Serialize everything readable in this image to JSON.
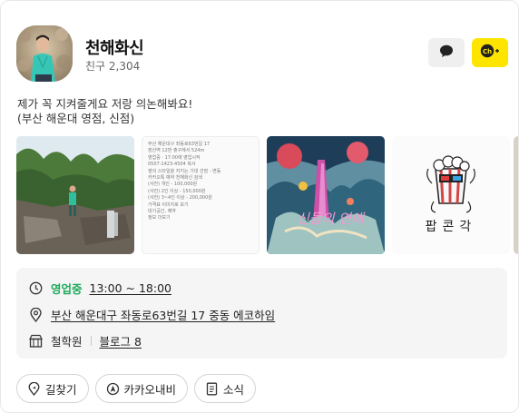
{
  "profile": {
    "name": "천해화신",
    "friends_label": "친구",
    "friends_count": "2,304",
    "description_line1": "제가 꼭 지켜줄게요 저랑 의논해봐요!",
    "description_line2": "(부산 해운대 영점, 신점)"
  },
  "header_buttons": {
    "chat_icon": "speech-bubble-icon",
    "channel_icon": "kakao-channel-add-icon",
    "channel_label": "Ch"
  },
  "thumbnails": [
    {
      "name": "photo-forest-waterfall",
      "alt": "숲 폭포 사진"
    },
    {
      "name": "photo-place-info-screenshot",
      "alt": "장소 정보 화면"
    },
    {
      "name": "photo-illustration-poster",
      "alt": "일러스트 포스터",
      "caption": "신들의 연애"
    },
    {
      "name": "photo-popcorn-sticker",
      "alt": "팝콘각 그림",
      "caption": "팝콘각"
    }
  ],
  "doc_thumb": {
    "lines": [
      "부산 해운대구 좌동로63번길 17",
      "장산역 12번 출구에서 524m",
      "영업중 · 17:00에 영업시작",
      "0507-1423-4504  복사",
      "영의 스타일을 지키는 기대 선점 - 변동",
      "카카오톡 예약 천해화신 검색",
      "(사전) 개인 - 100,000원",
      "(사전) 2인 이상 - 150,000원",
      "(사전) 3~4인 이상 - 200,000원",
      "가격표 이미지로 보기",
      "대기공간, 예약",
      "정보 더보기"
    ]
  },
  "info": {
    "status": "영업중",
    "hours": "13:00 ~ 18:00",
    "address": "부산 해운대구 좌동로63번길 17 중동 에코하임",
    "category": "철학원",
    "blog_label": "블로그",
    "blog_count": "8"
  },
  "actions": {
    "directions": "길찾기",
    "kakaonavi": "카카오내비",
    "news": "소식"
  },
  "colors": {
    "accent_yellow": "#fee500",
    "open_green": "#1faa5b",
    "info_bg": "#f5f5f5"
  }
}
